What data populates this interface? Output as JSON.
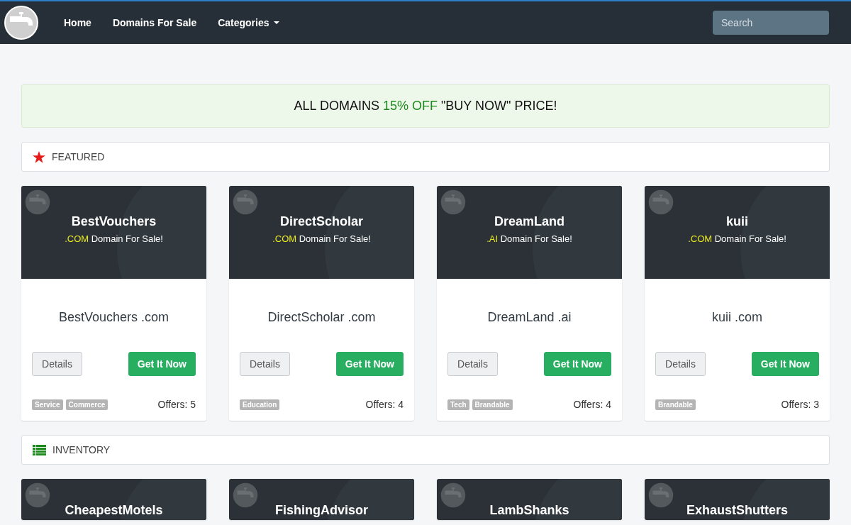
{
  "nav": {
    "links": [
      {
        "label": "Home",
        "kind": "link"
      },
      {
        "label": "Domains For Sale",
        "kind": "link"
      },
      {
        "label": "Categories",
        "kind": "dropdown"
      }
    ],
    "search": {
      "placeholder": "Search"
    }
  },
  "banner": {
    "before": "ALL DOMAINS ",
    "highlight": "15% OFF",
    "after": " \"BUY NOW\" PRICE!"
  },
  "featured": {
    "title": "FEATURED",
    "kind": "star",
    "cards": [
      {
        "name": "BestVouchers",
        "tld": ".COM",
        "tagline": " Domain For Sale!",
        "domain": "BestVouchers .com",
        "details": "Details",
        "buy": "Get It Now",
        "tags": [
          "Service",
          "Commerce"
        ],
        "offers": "Offers: 5"
      },
      {
        "name": "DirectScholar",
        "tld": ".COM",
        "tagline": " Domain For Sale!",
        "domain": "DirectScholar .com",
        "details": "Details",
        "buy": "Get It Now",
        "tags": [
          "Education"
        ],
        "offers": "Offers: 4"
      },
      {
        "name": "DreamLand",
        "tld": ".AI",
        "tagline": " Domain For Sale!",
        "domain": "DreamLand .ai",
        "details": "Details",
        "buy": "Get It Now",
        "tags": [
          "Tech",
          "Brandable"
        ],
        "offers": "Offers: 4"
      },
      {
        "name": "kuii",
        "tld": ".COM",
        "tagline": " Domain For Sale!",
        "domain": "kuii .com",
        "details": "Details",
        "buy": "Get It Now",
        "tags": [
          "Brandable"
        ],
        "offers": "Offers: 3"
      }
    ]
  },
  "inventory": {
    "title": "INVENTORY",
    "kind": "list",
    "cards": [
      {
        "name": "CheapestMotels"
      },
      {
        "name": "FishingAdvisor"
      },
      {
        "name": "LambShanks"
      },
      {
        "name": "ExhaustShutters"
      }
    ]
  }
}
